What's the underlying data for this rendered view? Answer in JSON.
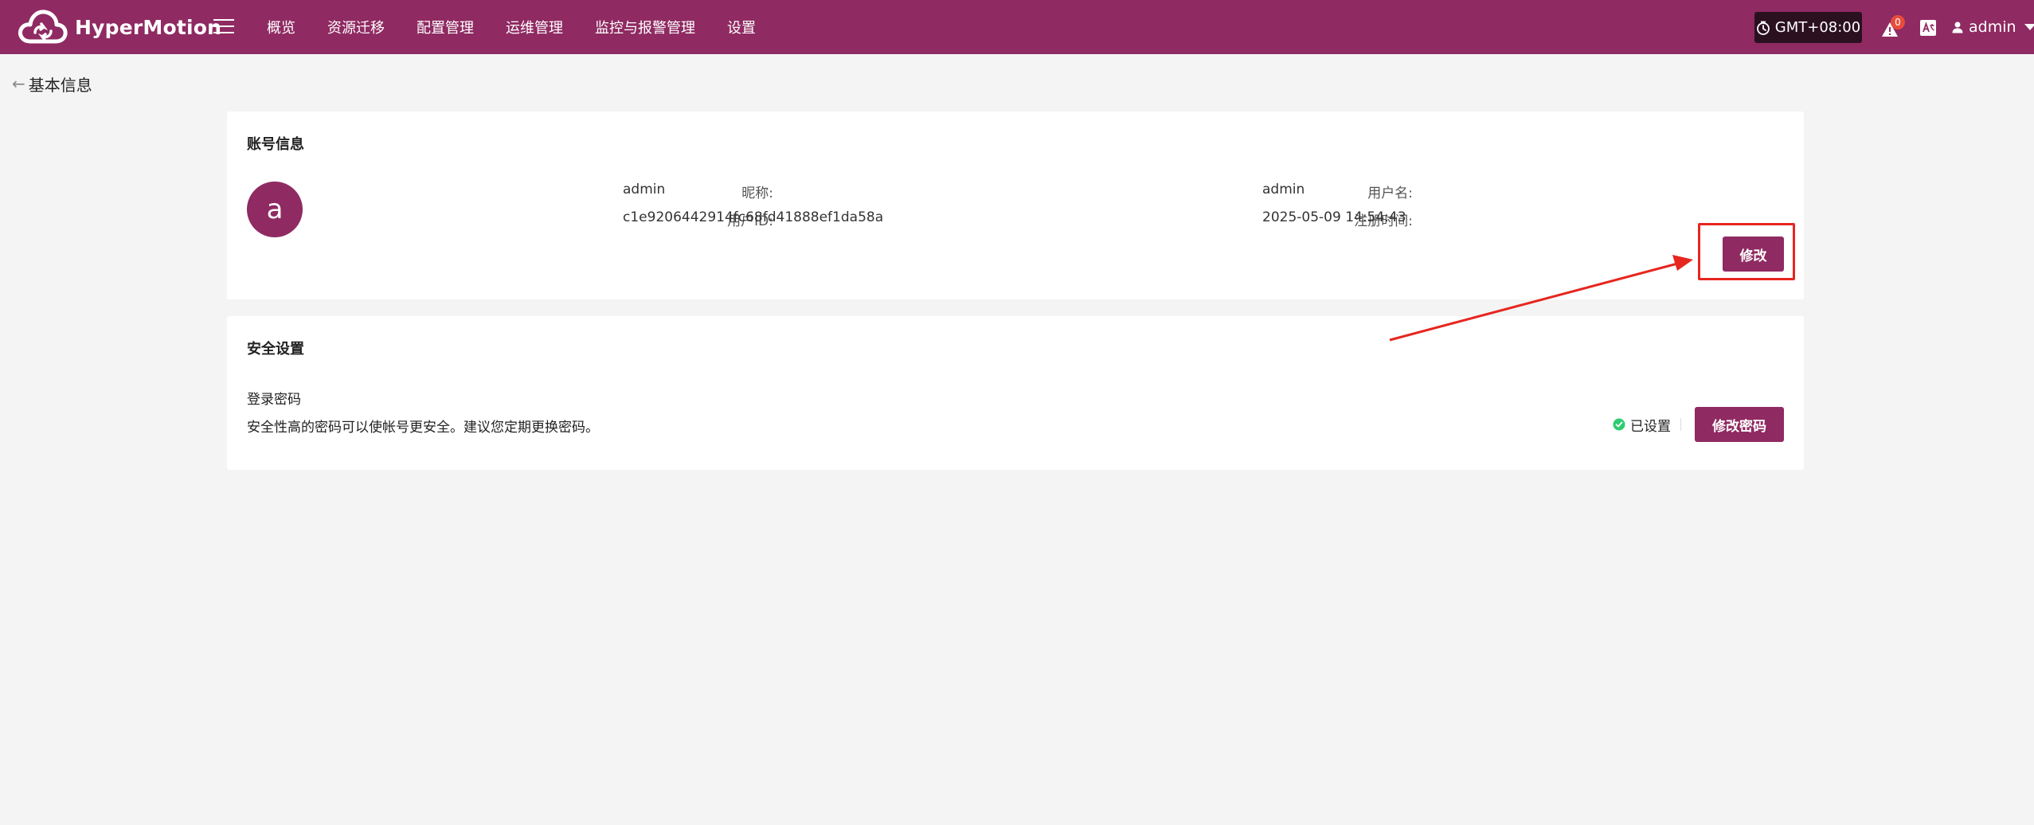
{
  "app": {
    "name": "HyperMotion"
  },
  "nav": {
    "items": [
      "概览",
      "资源迁移",
      "配置管理",
      "运维管理",
      "监控与报警管理",
      "设置"
    ]
  },
  "header": {
    "timezone": "GMT+08:00",
    "alert_count": "0",
    "username": "admin"
  },
  "page": {
    "back_title": "基本信息"
  },
  "account": {
    "title": "账号信息",
    "avatar_letter": "a",
    "nickname_label": "昵称:",
    "nickname_value": "admin",
    "userid_label": "用户ID:",
    "userid_value": "c1e9206442914fc68fd41888ef1da58a",
    "username_label": "用户名:",
    "username_value": "admin",
    "registered_label": "注册时间:",
    "registered_value": "2025-05-09 14:54:43",
    "edit_button": "修改"
  },
  "security": {
    "title": "安全设置",
    "password_title": "登录密码",
    "password_desc": "安全性高的密码可以使帐号更安全。建议您定期更换密码。",
    "status_text": "已设置",
    "change_password_button": "修改密码"
  },
  "colors": {
    "brand": "#8f2a62",
    "annotation": "#e6261f",
    "status_ok": "#2ecc71"
  },
  "icons": {
    "logo": "cloud-logo-icon",
    "menu": "hamburger-menu-icon",
    "timezone": "clock-icon",
    "alert": "warning-triangle-icon",
    "language": "translate-icon",
    "user": "user-icon",
    "back": "back-arrow-icon",
    "status": "check-circle-icon"
  }
}
